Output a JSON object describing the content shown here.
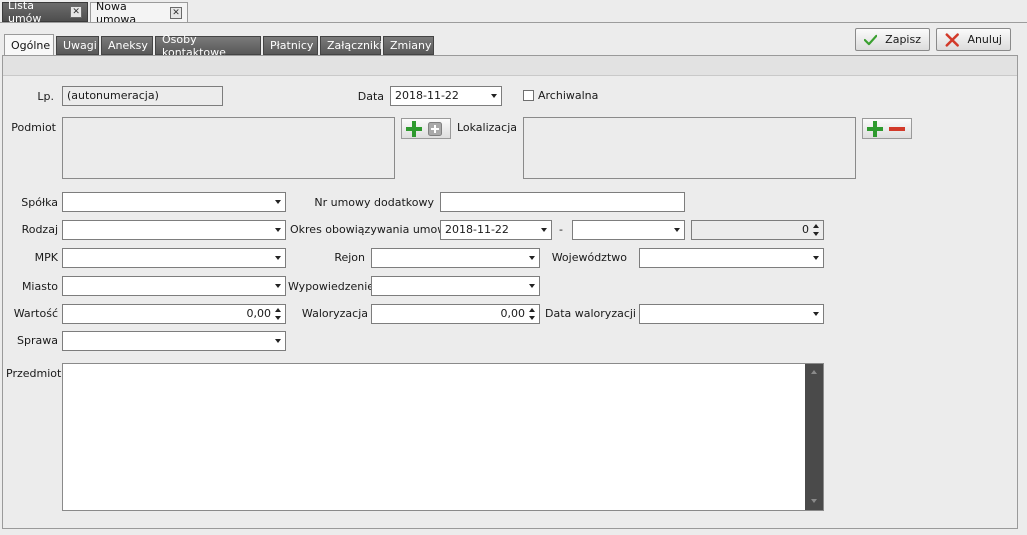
{
  "doc_tabs": [
    {
      "label": "Lista umów"
    },
    {
      "label": "Nowa umowa"
    }
  ],
  "inner_tabs": [
    "Ogólne",
    "Uwagi",
    "Aneksy",
    "Osoby kontaktowe",
    "Płatnicy",
    "Załączniki",
    "Zmiany"
  ],
  "actions": {
    "save_label": "Zapisz",
    "cancel_label": "Anuluj"
  },
  "form": {
    "lp_label": "Lp.",
    "lp_value": "(autonumeracja)",
    "data_label": "Data",
    "data_value": "2018-11-22",
    "archiwalna_label": "Archiwalna",
    "podmiot_label": "Podmiot",
    "lokalizacja_label": "Lokalizacja",
    "spolka_label": "Spółka",
    "nr_umowy_dod_label": "Nr umowy dodatkowy",
    "rodzaj_label": "Rodzaj",
    "okres_label": "Okres obowiązywania umowy",
    "okres_od_value": "2018-11-22",
    "okres_separator": "-",
    "okres_count_value": "0",
    "mpk_label": "MPK",
    "rejon_label": "Rejon",
    "wojewodztwo_label": "Województwo",
    "miasto_label": "Miasto",
    "wypowiedzenie_label": "Wypowiedzenie",
    "wartosc_label": "Wartość",
    "wartosc_value": "0,00",
    "waloryzacja_label": "Waloryzacja",
    "waloryzacja_value": "0,00",
    "data_waloryzacji_label": "Data waloryzacji",
    "sprawa_label": "Sprawa",
    "przedmiot_label": "Przedmiot"
  },
  "colors": {
    "add_icon": "#2e9a2e",
    "remove_icon": "#d23a2a",
    "save_check": "#3aa030",
    "cancel_x": "#d23a2a"
  }
}
